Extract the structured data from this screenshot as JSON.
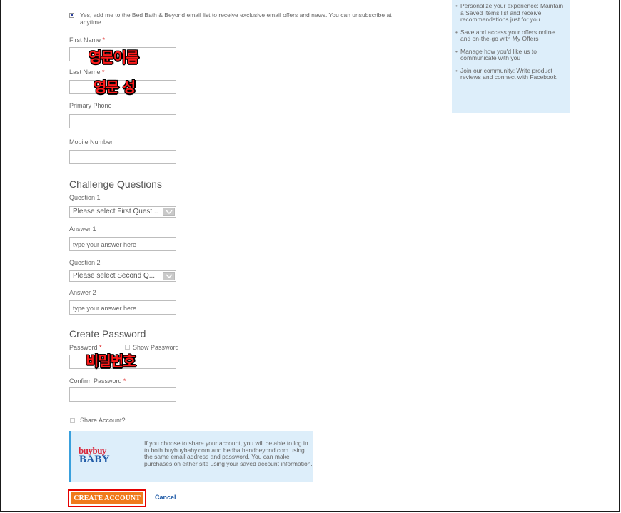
{
  "email_optin": {
    "checked": true,
    "text": "Yes, add me to the Bed Bath & Beyond email list to receive exclusive email offers and news. You can unsubscribe at anytime."
  },
  "fields": {
    "first_name_label": "First Name",
    "last_name_label": "Last Name",
    "primary_phone_label": "Primary Phone",
    "mobile_number_label": "Mobile Number",
    "required_mark": "*"
  },
  "overlays": {
    "first_name": "영문이름",
    "last_name": "영문 성",
    "password": "비밀번호"
  },
  "challenge": {
    "heading": "Challenge Questions",
    "question1_label": "Question 1",
    "question1_value": "Please select First Quest...",
    "answer1_label": "Answer 1",
    "answer1_placeholder": "type your answer here",
    "question2_label": "Question 2",
    "question2_value": "Please select Second Q...",
    "answer2_label": "Answer 2",
    "answer2_placeholder": "type your answer here"
  },
  "password": {
    "heading": "Create Password",
    "password_label": "Password",
    "show_password_label": "Show Password",
    "confirm_label": "Confirm Password"
  },
  "share": {
    "label": "Share Account?",
    "info": "If you choose to share your account, you will be able to log in to both buybuybaby.com and bedbathandbeyond.com using the same email address and password. You can make purchases on either site using your saved account information.",
    "logo_line1": "buybuy",
    "logo_line2": "BABY"
  },
  "actions": {
    "create_account": "CREATE ACCOUNT",
    "cancel": "Cancel"
  },
  "sidebar": {
    "items": [
      "Personalize your experience: Maintain a Saved Items list and receive recommendations just for you",
      "Save and access your offers online and on-the-go with My Offers",
      "Manage how you'd like us to communicate with you",
      "Join our community: Write product reviews and connect with Facebook"
    ]
  },
  "colors": {
    "accent_orange": "#f07a1c",
    "link_blue": "#1f5aa6",
    "info_bg": "#ddeefa",
    "overlay_red": "#ff1a1a"
  }
}
